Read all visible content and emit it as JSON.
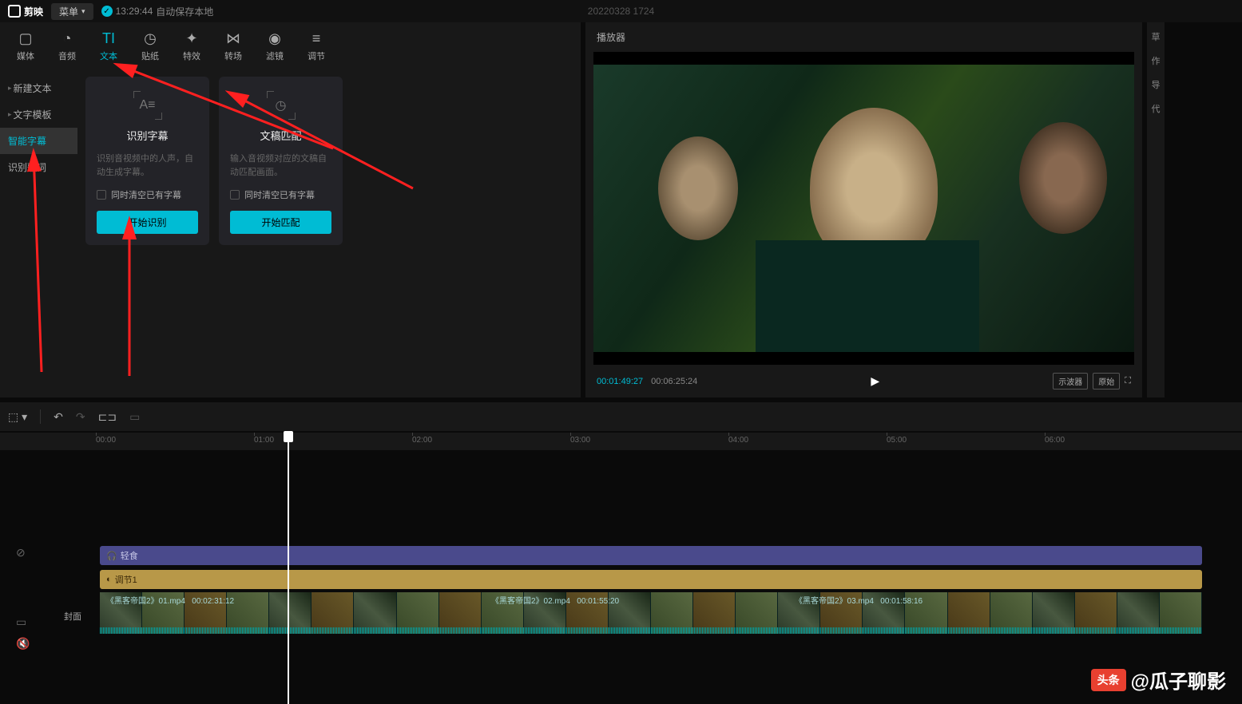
{
  "app": {
    "name": "剪映",
    "menu": "菜单"
  },
  "status": {
    "time": "13:29:44",
    "text": "自动保存本地"
  },
  "project": "20220328 1724",
  "tabs": [
    {
      "label": "媒体",
      "icon": "▢"
    },
    {
      "label": "音频",
      "icon": "◔"
    },
    {
      "label": "文本",
      "icon": "TI"
    },
    {
      "label": "贴纸",
      "icon": "◷"
    },
    {
      "label": "特效",
      "icon": "✦"
    },
    {
      "label": "转场",
      "icon": "⋈"
    },
    {
      "label": "滤镜",
      "icon": "◉"
    },
    {
      "label": "调节",
      "icon": "≡"
    }
  ],
  "sidebar": [
    {
      "label": "新建文本"
    },
    {
      "label": "文字模板"
    },
    {
      "label": "智能字幕"
    },
    {
      "label": "识别歌词"
    }
  ],
  "cards": {
    "recognize": {
      "title": "识别字幕",
      "desc": "识别音视频中的人声，自动生成字幕。",
      "check": "同时清空已有字幕",
      "btn": "开始识别"
    },
    "match": {
      "title": "文稿匹配",
      "desc": "输入音视频对应的文稿自动匹配画面。",
      "check": "同时清空已有字幕",
      "btn": "开始匹配"
    }
  },
  "player": {
    "title": "播放器",
    "current": "00:01:49:27",
    "total": "00:06:25:24",
    "scope": "示波器",
    "original": "原始"
  },
  "rightStrip": [
    "草",
    "作",
    "导",
    "代"
  ],
  "ruler": [
    "00:00",
    "01:00",
    "02:00",
    "03:00",
    "04:00",
    "05:00",
    "06:00"
  ],
  "tracks": {
    "audio": "轻食",
    "adjust": "调节1",
    "clips": [
      {
        "name": "《黑客帝国2》01.mp4",
        "dur": "00:02:31:12"
      },
      {
        "name": "《黑客帝国2》02.mp4",
        "dur": "00:01:55:20"
      },
      {
        "name": "《黑客帝国2》03.mp4",
        "dur": "00:01:58:16"
      }
    ]
  },
  "cover": "封面",
  "watermark": {
    "badge": "头条",
    "text": "@瓜子聊影"
  }
}
